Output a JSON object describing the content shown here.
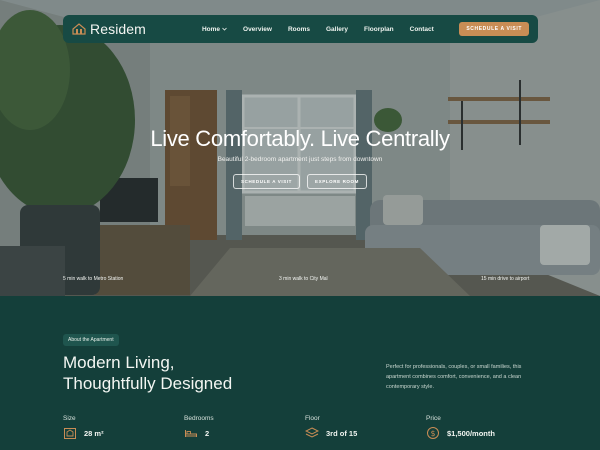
{
  "brand": {
    "name": "Residem"
  },
  "nav": {
    "items": [
      {
        "label": "Home",
        "has_dropdown": true
      },
      {
        "label": "Overview"
      },
      {
        "label": "Rooms"
      },
      {
        "label": "Gallery"
      },
      {
        "label": "Floorplan"
      },
      {
        "label": "Contact"
      }
    ],
    "cta": "SCHEDULE A VISIT"
  },
  "hero": {
    "headline": "Live Comfortably. Live Centrally",
    "subline": "Beautiful 2-bedroom apartment just steps from downtown",
    "buttons": [
      "SCHEDULE A VISIT",
      "EXPLORE ROOM"
    ],
    "locations": [
      "5 min walk to Metro Station",
      "3 min walk to City Mal",
      "15 min drive to airport"
    ]
  },
  "about": {
    "badge": "About the Apartment",
    "title_line1": "Modern Living,",
    "title_line2": "Thoughtfully Designed",
    "description": "Perfect for professionals, couples, or small families, this apartment combines comfort, convenience, and a clean contemporary style."
  },
  "specs": [
    {
      "label": "Size",
      "value": "28 m²",
      "icon": "size-icon"
    },
    {
      "label": "Bedrooms",
      "value": "2",
      "icon": "bed-icon"
    },
    {
      "label": "Floor",
      "value": "3rd of 15",
      "icon": "layers-icon"
    },
    {
      "label": "Price",
      "value": "$1,500/month",
      "icon": "dollar-icon"
    }
  ],
  "colors": {
    "accent": "#c98d55",
    "background": "#143f3a",
    "nav": "#174a44"
  }
}
